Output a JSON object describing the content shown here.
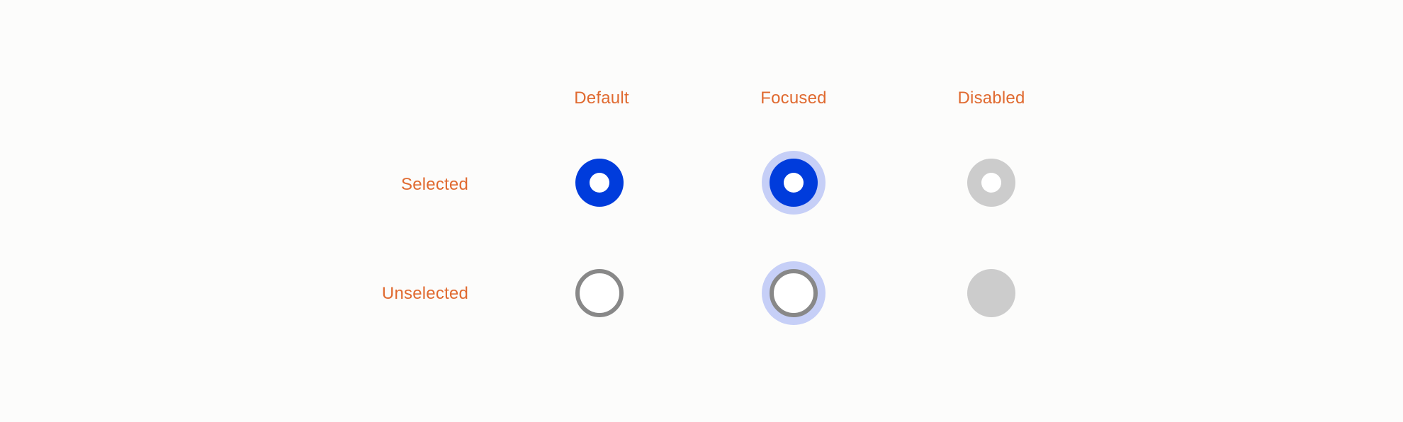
{
  "columns": {
    "default": "Default",
    "focused": "Focused",
    "disabled": "Disabled"
  },
  "rows": {
    "selected": "Selected",
    "unselected": "Unselected"
  },
  "colors": {
    "label": "#e06a30",
    "selected_fill": "#003cdc",
    "focus_ring": "#c6cff7",
    "unselected_border": "#888888",
    "disabled_fill": "#cccccc",
    "background": "#fcfcfb"
  }
}
